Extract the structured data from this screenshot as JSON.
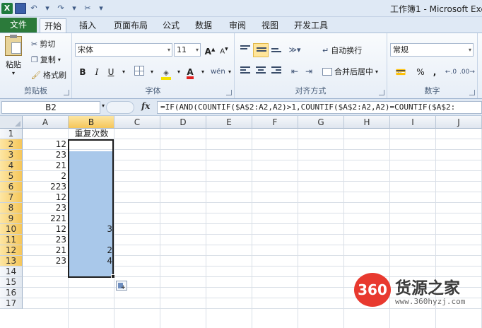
{
  "window": {
    "title": "工作簿1 - Microsoft Exce"
  },
  "quick_access": {
    "app_icon": "excel-logo-icon",
    "app_letter": "X"
  },
  "tabs": {
    "file": "文件",
    "items": [
      "开始",
      "插入",
      "页面布局",
      "公式",
      "数据",
      "审阅",
      "视图",
      "开发工具"
    ],
    "active": "开始"
  },
  "ribbon": {
    "clipboard": {
      "paste": "粘贴",
      "cut": "剪切",
      "copy": "复制",
      "format_painter": "格式刷",
      "label": "剪贴板"
    },
    "font": {
      "name": "宋体",
      "size": "11",
      "bold": "B",
      "italic": "I",
      "underline": "U",
      "grow": "A",
      "shrink": "A",
      "phonetic": "wén",
      "label": "字体"
    },
    "alignment": {
      "wrap": "自动换行",
      "merge": "合并后居中",
      "label": "对齐方式"
    },
    "number": {
      "format": "常规",
      "percent": "%",
      "comma": ",",
      "label": "数字"
    }
  },
  "formula_bar": {
    "name_box": "B2",
    "fx": "fx",
    "formula": "=IF(AND(COUNTIF($A$2:A2,A2)>1,COUNTIF($A$2:A2,A2)=COUNTIF($A$2:"
  },
  "sheet": {
    "columns": [
      "A",
      "B",
      "C",
      "D",
      "E",
      "F",
      "G",
      "H",
      "I",
      "J"
    ],
    "rows": [
      "1",
      "2",
      "3",
      "4",
      "5",
      "6",
      "7",
      "8",
      "9",
      "10",
      "11",
      "12",
      "13",
      "14",
      "15",
      "16",
      "17"
    ],
    "header_b1": "重复次数",
    "col_a": [
      "12",
      "23",
      "21",
      "2",
      "223",
      "12",
      "23",
      "221",
      "12",
      "23",
      "21",
      "23"
    ],
    "col_b": [
      "",
      "",
      "",
      "",
      "",
      "",
      "",
      "",
      "3",
      "",
      "2",
      "4"
    ],
    "selected_column": "B",
    "selected_range": "B2:B13"
  },
  "watermark": {
    "badge": "360",
    "text": "货源之家",
    "url": "www.360hyzj.com"
  }
}
